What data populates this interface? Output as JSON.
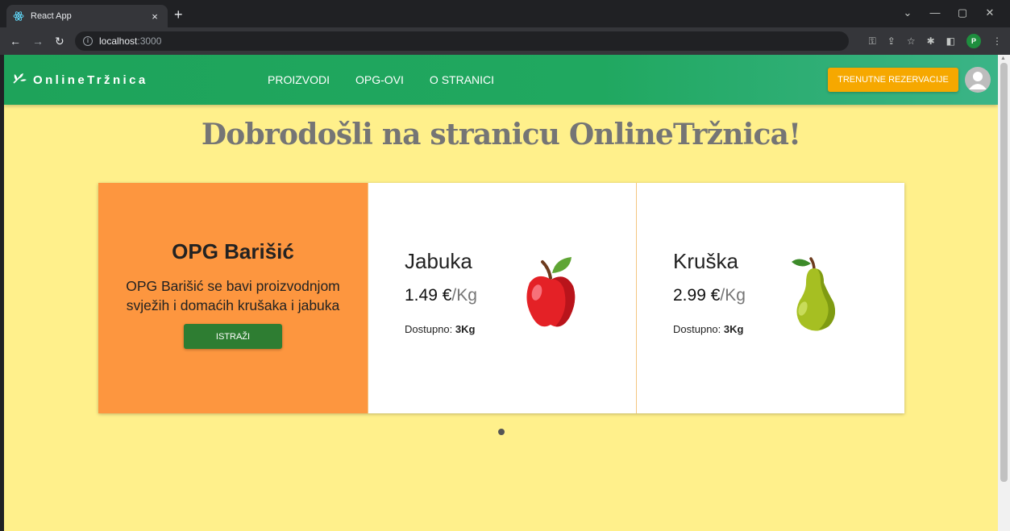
{
  "browser": {
    "tab_title": "React App",
    "tab_close": "×",
    "new_tab": "+",
    "url_host": "localhost",
    "url_port": ":3000",
    "profile_letter": "P"
  },
  "navbar": {
    "brand": "OnlineTržnica",
    "links": [
      "PROIZVODI",
      "OPG-OVI",
      "O STRANICI"
    ],
    "reserve_button": "TRENUTNE REZERVACIJE"
  },
  "page": {
    "title": "Dobrodošli na stranicu OnlineTržnica!"
  },
  "farm": {
    "name": "OPG Barišić",
    "description": "OPG Barišić se bavi proizvodnjom svježih i domaćih krušaka i jabuka",
    "button": "ISTRAŽI"
  },
  "products": [
    {
      "name": "Jabuka",
      "price": "1.49 €",
      "unit": "/Kg",
      "avail_label": "Dostupno:",
      "avail_value": "3Kg",
      "icon": "apple-icon"
    },
    {
      "name": "Kruška",
      "price": "2.99 €",
      "unit": "/Kg",
      "avail_label": "Dostupno:",
      "avail_value": "3Kg",
      "icon": "pear-icon"
    }
  ],
  "carousel": {
    "slides": 1,
    "active": 1
  },
  "colors": {
    "page_bg": "#fff08b",
    "navbar": "#1ea35a",
    "reserve_button": "#f6a800",
    "farm_card": "#fd963f",
    "explore_button": "#2e7d32"
  }
}
